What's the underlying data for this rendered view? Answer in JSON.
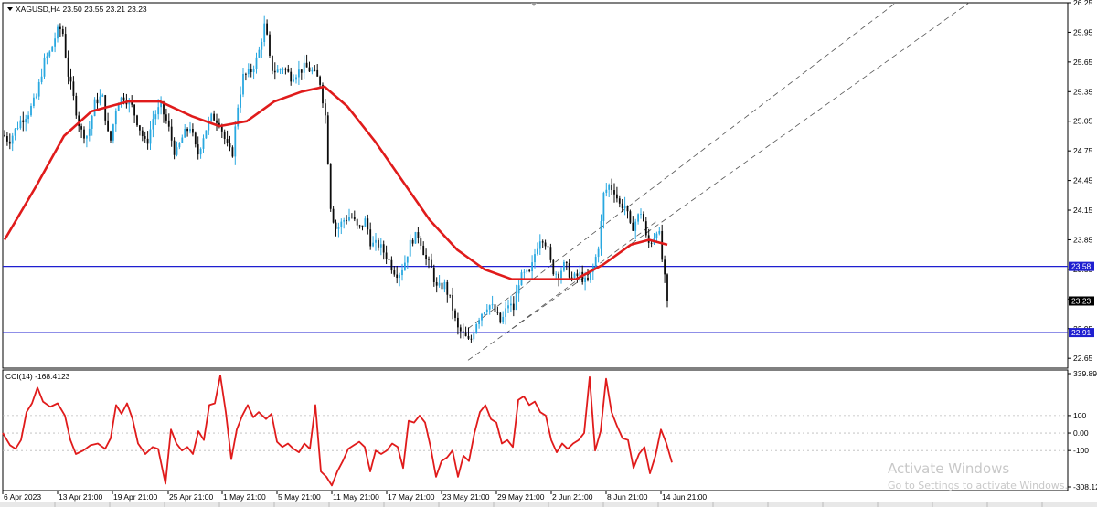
{
  "header": {
    "symbol_line": "XAGUSD,H4  23.50 23.55 23.21 23.23",
    "indicator_line": "CCI(14) -168.4123"
  },
  "watermark": {
    "title": "Activate Windows",
    "subtitle": "Go to Settings to activate Windows."
  },
  "colors": {
    "bull": "#29a8e0",
    "bear": "#0b0b0b",
    "ma": "#e01b1b",
    "level_line": "#1f1fd0",
    "channel": "#555555",
    "cci": "#e01b1b"
  },
  "chart_data": [
    {
      "type": "candlestick",
      "symbol": "XAGUSD",
      "timeframe": "H4",
      "last_bar": {
        "open": 23.5,
        "high": 23.55,
        "low": 23.21,
        "close": 23.23
      },
      "ylim": [
        22.55,
        26.25
      ],
      "y_ticks": [
        "26.25",
        "25.95",
        "25.65",
        "25.35",
        "25.05",
        "24.75",
        "24.45",
        "24.15",
        "23.85",
        "23.55",
        "23.25",
        "22.95",
        "22.65"
      ],
      "x_ticks": [
        "6 Apr 2023",
        "13 Apr 21:00",
        "19 Apr 21:00",
        "25 Apr 21:00",
        "1 May 21:00",
        "5 May 21:00",
        "11 May 21:00",
        "17 May 21:00",
        "23 May 21:00",
        "29 May 21:00",
        "2 Jun 21:00",
        "8 Jun 21:00",
        "14 Jun 21:00"
      ],
      "price_path": [
        [
          0,
          24.95
        ],
        [
          10,
          24.85
        ],
        [
          22,
          25.05
        ],
        [
          32,
          25.15
        ],
        [
          40,
          25.3
        ],
        [
          48,
          25.65
        ],
        [
          55,
          25.75
        ],
        [
          62,
          25.95
        ],
        [
          68,
          26.0
        ],
        [
          74,
          25.55
        ],
        [
          80,
          25.3
        ],
        [
          88,
          24.95
        ],
        [
          96,
          24.9
        ],
        [
          104,
          25.25
        ],
        [
          112,
          25.3
        ],
        [
          120,
          24.8
        ],
        [
          128,
          25.25
        ],
        [
          136,
          25.3
        ],
        [
          144,
          25.2
        ],
        [
          152,
          25.0
        ],
        [
          160,
          24.8
        ],
        [
          168,
          25.1
        ],
        [
          176,
          25.2
        ],
        [
          184,
          25.0
        ],
        [
          192,
          24.7
        ],
        [
          200,
          24.9
        ],
        [
          208,
          25.0
        ],
        [
          216,
          24.7
        ],
        [
          224,
          24.95
        ],
        [
          232,
          25.1
        ],
        [
          240,
          25.05
        ],
        [
          248,
          24.8
        ],
        [
          254,
          24.7
        ],
        [
          260,
          25.2
        ],
        [
          266,
          25.5
        ],
        [
          274,
          25.55
        ],
        [
          282,
          25.7
        ],
        [
          290,
          26.05
        ],
        [
          296,
          25.6
        ],
        [
          302,
          25.55
        ],
        [
          310,
          25.6
        ],
        [
          318,
          25.5
        ],
        [
          326,
          25.55
        ],
        [
          334,
          25.6
        ],
        [
          342,
          25.55
        ],
        [
          350,
          25.45
        ],
        [
          356,
          25.1
        ],
        [
          362,
          24.15
        ],
        [
          368,
          23.95
        ],
        [
          376,
          24.05
        ],
        [
          384,
          24.1
        ],
        [
          392,
          23.95
        ],
        [
          400,
          24.05
        ],
        [
          406,
          23.8
        ],
        [
          414,
          23.8
        ],
        [
          422,
          23.7
        ],
        [
          430,
          23.55
        ],
        [
          436,
          23.5
        ],
        [
          442,
          23.6
        ],
        [
          450,
          23.85
        ],
        [
          458,
          23.9
        ],
        [
          466,
          23.65
        ],
        [
          472,
          23.55
        ],
        [
          478,
          23.35
        ],
        [
          486,
          23.4
        ],
        [
          494,
          23.2
        ],
        [
          500,
          22.95
        ],
        [
          506,
          22.9
        ],
        [
          514,
          22.8
        ],
        [
          520,
          23.0
        ],
        [
          526,
          23.1
        ],
        [
          534,
          23.2
        ],
        [
          540,
          23.15
        ],
        [
          548,
          23.0
        ],
        [
          556,
          23.2
        ],
        [
          562,
          23.15
        ],
        [
          568,
          23.45
        ],
        [
          574,
          23.5
        ],
        [
          580,
          23.5
        ],
        [
          586,
          23.75
        ],
        [
          592,
          23.9
        ],
        [
          598,
          23.8
        ],
        [
          604,
          23.55
        ],
        [
          610,
          23.5
        ],
        [
          618,
          23.6
        ],
        [
          626,
          23.45
        ],
        [
          634,
          23.5
        ],
        [
          642,
          23.4
        ],
        [
          650,
          23.6
        ],
        [
          656,
          23.85
        ],
        [
          660,
          24.3
        ],
        [
          666,
          24.4
        ],
        [
          672,
          24.35
        ],
        [
          678,
          24.2
        ],
        [
          684,
          24.2
        ],
        [
          690,
          23.95
        ],
        [
          696,
          24.05
        ],
        [
          702,
          24.15
        ],
        [
          708,
          23.8
        ],
        [
          714,
          23.85
        ],
        [
          720,
          24.0
        ],
        [
          726,
          23.5
        ],
        [
          732,
          23.23
        ]
      ],
      "moving_average": {
        "path": [
          [
            5,
            23.85
          ],
          [
            40,
            24.4
          ],
          [
            70,
            24.9
          ],
          [
            100,
            25.15
          ],
          [
            140,
            25.25
          ],
          [
            175,
            25.25
          ],
          [
            210,
            25.1
          ],
          [
            240,
            25.0
          ],
          [
            270,
            25.05
          ],
          [
            300,
            25.25
          ],
          [
            330,
            25.35
          ],
          [
            355,
            25.4
          ],
          [
            380,
            25.2
          ],
          [
            410,
            24.85
          ],
          [
            440,
            24.45
          ],
          [
            470,
            24.05
          ],
          [
            500,
            23.75
          ],
          [
            530,
            23.55
          ],
          [
            560,
            23.45
          ],
          [
            600,
            23.45
          ],
          [
            630,
            23.45
          ],
          [
            660,
            23.6
          ],
          [
            690,
            23.8
          ],
          [
            710,
            23.85
          ],
          [
            730,
            23.8
          ]
        ]
      },
      "horizontal_levels": [
        {
          "label": "23.58",
          "value": 23.58
        },
        {
          "label": "22.91",
          "value": 22.91
        }
      ],
      "current_price": {
        "label": "23.23",
        "value": 23.23
      },
      "trend_channel": [
        {
          "from": [
            512,
            22.63
          ],
          "to": [
            1060,
            26.25
          ]
        },
        {
          "from": [
            512,
            22.95
          ],
          "to": [
            980,
            26.25
          ]
        },
        {
          "from": [
            560,
            22.95
          ],
          "to": [
            720,
            24.05
          ]
        }
      ]
    },
    {
      "type": "line",
      "name": "CCI(14)",
      "ylim": [
        -308.1271,
        339.893
      ],
      "y_ticks": [
        "339.893",
        "100",
        "0.00",
        "-100",
        "-308.127"
      ],
      "path": [
        [
          0,
          0
        ],
        [
          8,
          -70
        ],
        [
          14,
          -90
        ],
        [
          20,
          -40
        ],
        [
          26,
          120
        ],
        [
          32,
          170
        ],
        [
          38,
          260
        ],
        [
          44,
          180
        ],
        [
          52,
          150
        ],
        [
          60,
          170
        ],
        [
          68,
          100
        ],
        [
          74,
          -40
        ],
        [
          80,
          -120
        ],
        [
          88,
          -100
        ],
        [
          96,
          -70
        ],
        [
          104,
          -60
        ],
        [
          112,
          -90
        ],
        [
          118,
          -30
        ],
        [
          124,
          160
        ],
        [
          130,
          110
        ],
        [
          136,
          170
        ],
        [
          142,
          80
        ],
        [
          148,
          -60
        ],
        [
          156,
          -120
        ],
        [
          164,
          -80
        ],
        [
          170,
          -90
        ],
        [
          178,
          -290
        ],
        [
          184,
          20
        ],
        [
          190,
          -60
        ],
        [
          196,
          -100
        ],
        [
          202,
          -80
        ],
        [
          208,
          -120
        ],
        [
          214,
          10
        ],
        [
          220,
          -40
        ],
        [
          226,
          160
        ],
        [
          232,
          170
        ],
        [
          238,
          330
        ],
        [
          244,
          120
        ],
        [
          250,
          -150
        ],
        [
          256,
          20
        ],
        [
          262,
          100
        ],
        [
          268,
          160
        ],
        [
          274,
          90
        ],
        [
          280,
          120
        ],
        [
          288,
          80
        ],
        [
          294,
          110
        ],
        [
          300,
          -50
        ],
        [
          306,
          -80
        ],
        [
          312,
          -60
        ],
        [
          318,
          -90
        ],
        [
          324,
          -110
        ],
        [
          330,
          -60
        ],
        [
          336,
          -90
        ],
        [
          342,
          160
        ],
        [
          348,
          -220
        ],
        [
          354,
          -250
        ],
        [
          360,
          -300
        ],
        [
          366,
          -220
        ],
        [
          372,
          -160
        ],
        [
          378,
          -90
        ],
        [
          384,
          -70
        ],
        [
          390,
          -50
        ],
        [
          396,
          -80
        ],
        [
          402,
          -220
        ],
        [
          408,
          -100
        ],
        [
          414,
          -120
        ],
        [
          420,
          -100
        ],
        [
          426,
          -60
        ],
        [
          432,
          -80
        ],
        [
          438,
          -200
        ],
        [
          444,
          70
        ],
        [
          450,
          60
        ],
        [
          456,
          100
        ],
        [
          462,
          60
        ],
        [
          468,
          -80
        ],
        [
          474,
          -250
        ],
        [
          480,
          -160
        ],
        [
          486,
          -140
        ],
        [
          492,
          -100
        ],
        [
          498,
          -250
        ],
        [
          504,
          -130
        ],
        [
          510,
          -160
        ],
        [
          516,
          0
        ],
        [
          522,
          120
        ],
        [
          528,
          160
        ],
        [
          534,
          80
        ],
        [
          540,
          60
        ],
        [
          546,
          -60
        ],
        [
          552,
          -40
        ],
        [
          558,
          -80
        ],
        [
          564,
          190
        ],
        [
          570,
          210
        ],
        [
          576,
          160
        ],
        [
          582,
          180
        ],
        [
          588,
          120
        ],
        [
          594,
          100
        ],
        [
          600,
          -40
        ],
        [
          606,
          -110
        ],
        [
          612,
          -60
        ],
        [
          618,
          -90
        ],
        [
          624,
          -60
        ],
        [
          630,
          -40
        ],
        [
          636,
          0
        ],
        [
          642,
          320
        ],
        [
          648,
          -100
        ],
        [
          654,
          10
        ],
        [
          660,
          310
        ],
        [
          666,
          120
        ],
        [
          672,
          40
        ],
        [
          678,
          -30
        ],
        [
          684,
          -40
        ],
        [
          690,
          -200
        ],
        [
          696,
          -120
        ],
        [
          702,
          -80
        ],
        [
          708,
          -230
        ],
        [
          714,
          -130
        ],
        [
          720,
          20
        ],
        [
          726,
          -60
        ],
        [
          732,
          -168.41
        ]
      ]
    }
  ]
}
